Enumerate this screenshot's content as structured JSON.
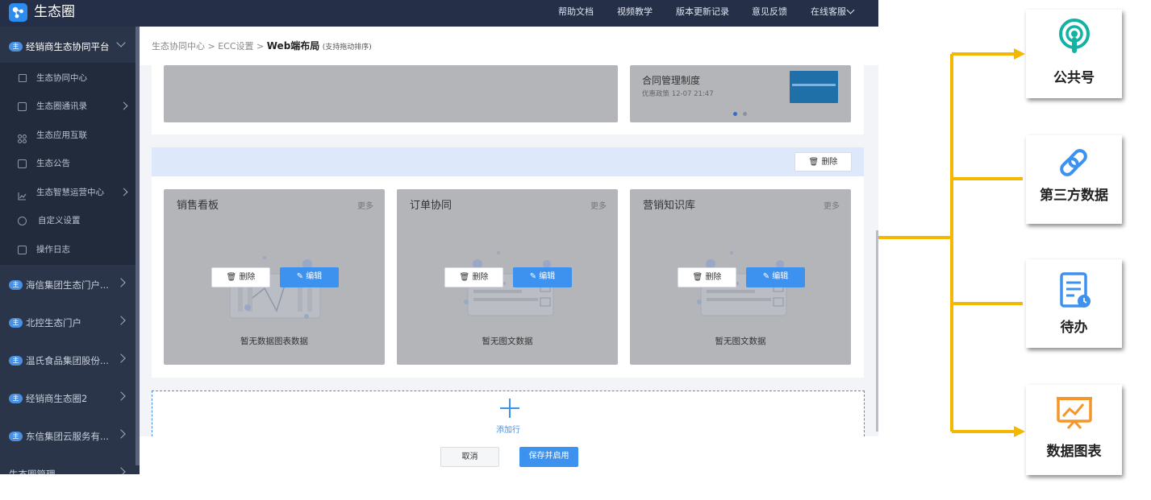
{
  "app": {
    "title": "生态圈"
  },
  "topnav": [
    "帮助文档",
    "视频教学",
    "版本更新记录",
    "意见反馈",
    "在线客服"
  ],
  "sidebar": {
    "badge": "主",
    "groups": [
      {
        "label": "经销商生态协同平台"
      },
      {
        "label": "海信集团生态门户..."
      },
      {
        "label": "北控生态门户"
      },
      {
        "label": "温氏食品集团股份..."
      },
      {
        "label": "经销商生态圈2"
      },
      {
        "label": "东信集团云服务有..."
      },
      {
        "label": "生态圈管理"
      }
    ],
    "items": [
      "生态协同中心",
      "生态圈通讯录",
      "生态应用互联",
      "生态公告",
      "生态智慧运营中心",
      "自定义设置",
      "操作日志"
    ]
  },
  "breadcrumb": {
    "parts": [
      "生态协同中心",
      "ECC设置"
    ],
    "current": "Web端布局",
    "hint": "(支持拖动排序)"
  },
  "top_card": {
    "title": "合同管理制度",
    "meta": "优惠政策 12-07 21:47"
  },
  "row_delete": "删除",
  "panels": [
    {
      "title": "销售看板",
      "more": "更多",
      "empty": "暂无数据图表数据",
      "delete": "删除",
      "edit": "编辑"
    },
    {
      "title": "订单协同",
      "more": "更多",
      "empty": "暂无图文数据",
      "delete": "删除",
      "edit": "编辑"
    },
    {
      "title": "营销知识库",
      "more": "更多",
      "empty": "暂无图文数据",
      "delete": "删除",
      "edit": "编辑"
    }
  ],
  "add_row": "添加行",
  "footer": {
    "cancel": "取消",
    "save": "保存并启用"
  },
  "legend": [
    "公共号",
    "第三方数据",
    "待办",
    "数据图表"
  ],
  "colors": {
    "accent": "#3d91ef",
    "connector": "#f5b800",
    "sidebar": "#2b3549",
    "topbar": "#253048"
  }
}
